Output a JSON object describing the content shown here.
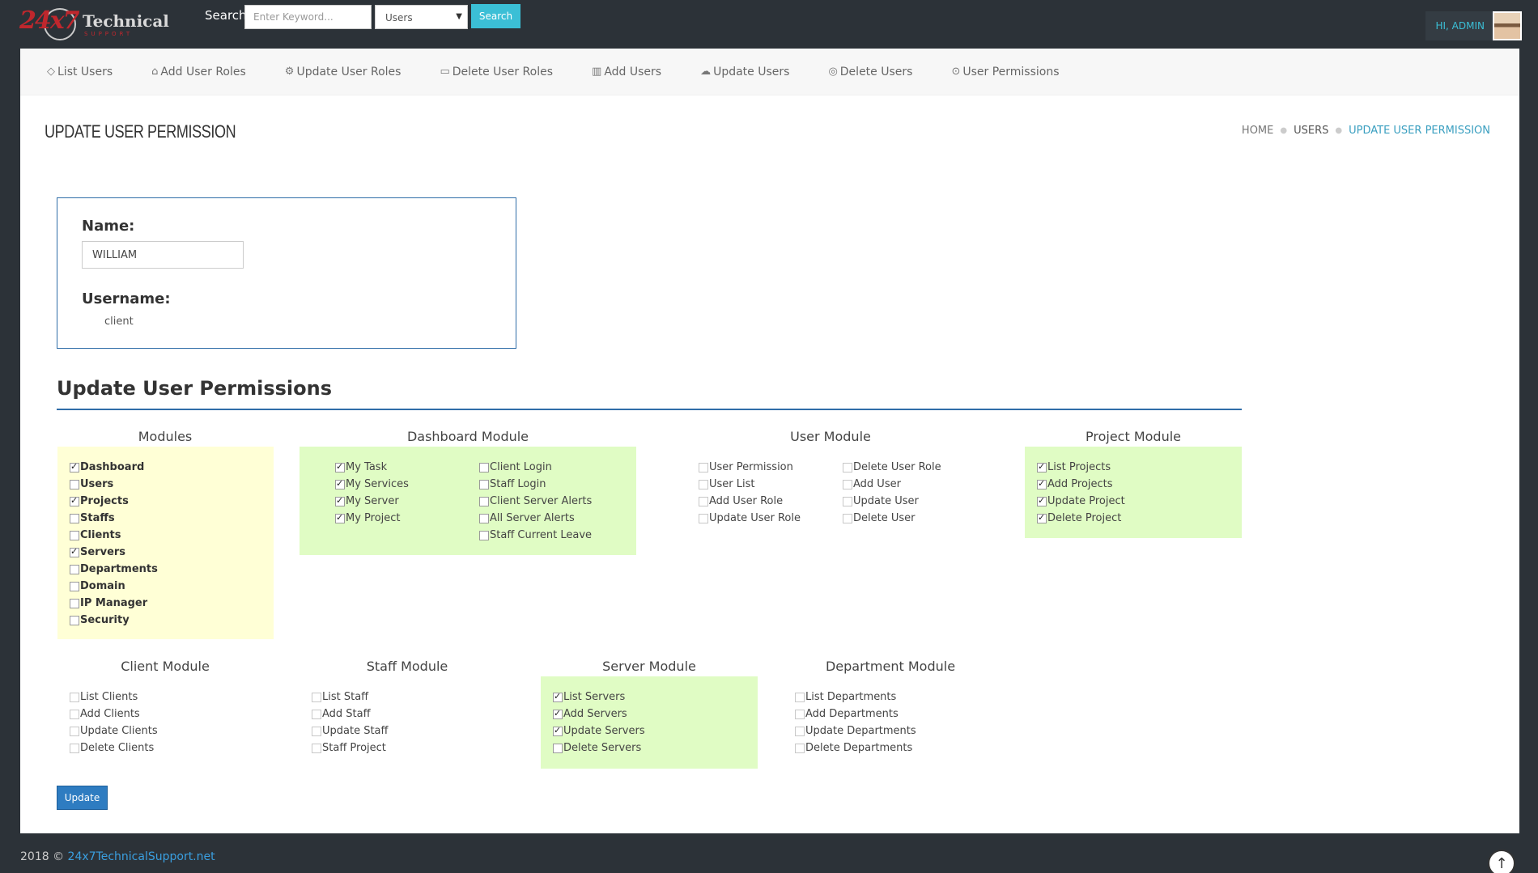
{
  "brand": {
    "logo_number": "24x7",
    "logo_text": "Technical",
    "logo_sub": "SUPPORT"
  },
  "search": {
    "label": "Search",
    "placeholder": "Enter Keyword...",
    "select_value": "Users",
    "button_label": "Search"
  },
  "user": {
    "greeting": "HI, ADMIN"
  },
  "nav": {
    "items": [
      {
        "label": "List Users",
        "icon": "diamond-icon",
        "glyph": "◇"
      },
      {
        "label": "Add User Roles",
        "icon": "tag-icon",
        "glyph": "⌂"
      },
      {
        "label": "Update User Roles",
        "icon": "gear-icon",
        "glyph": "⚙"
      },
      {
        "label": "Delete User Roles",
        "icon": "folder-icon",
        "glyph": "▭"
      },
      {
        "label": "Add Users",
        "icon": "bar-chart-icon",
        "glyph": "▥"
      },
      {
        "label": "Update Users",
        "icon": "cloud-upload-icon",
        "glyph": "☁"
      },
      {
        "label": "Delete Users",
        "icon": "globe-icon",
        "glyph": "◎"
      },
      {
        "label": "User Permissions",
        "icon": "map-pin-icon",
        "glyph": "⊙"
      }
    ]
  },
  "page": {
    "title": "UPDATE USER PERMISSION",
    "breadcrumb": [
      "HOME",
      "USERS",
      "UPDATE USER PERMISSION"
    ]
  },
  "profile": {
    "name_label": "Name:",
    "name_value": "WILLIAM",
    "username_label": "Username:",
    "username_value": "client"
  },
  "permissions": {
    "heading": "Update User Permissions",
    "update_label": "Update",
    "modules": {
      "title": "Modules",
      "items": [
        {
          "label": "Dashboard",
          "checked": true
        },
        {
          "label": "Users",
          "checked": false
        },
        {
          "label": "Projects",
          "checked": true
        },
        {
          "label": "Staffs",
          "checked": false
        },
        {
          "label": "Clients",
          "checked": false
        },
        {
          "label": "Servers",
          "checked": true
        },
        {
          "label": "Departments",
          "checked": false
        },
        {
          "label": "Domain",
          "checked": false
        },
        {
          "label": "IP Manager",
          "checked": false
        },
        {
          "label": "Security",
          "checked": false
        }
      ]
    },
    "dashboard": {
      "title": "Dashboard Module",
      "col1": [
        {
          "label": "My Task",
          "checked": true
        },
        {
          "label": "My Services",
          "checked": true
        },
        {
          "label": "My Server",
          "checked": true
        },
        {
          "label": "My Project",
          "checked": true
        }
      ],
      "col2": [
        {
          "label": "Client Login",
          "checked": false
        },
        {
          "label": "Staff Login",
          "checked": false
        },
        {
          "label": "Client Server Alerts",
          "checked": false
        },
        {
          "label": "All Server Alerts",
          "checked": false
        },
        {
          "label": "Staff Current Leave",
          "checked": false
        }
      ]
    },
    "user_module": {
      "title": "User Module",
      "col1": [
        {
          "label": "User Permission",
          "checked": false
        },
        {
          "label": "User List",
          "checked": false
        },
        {
          "label": "Add User Role",
          "checked": false
        },
        {
          "label": "Update User Role",
          "checked": false
        }
      ],
      "col2": [
        {
          "label": "Delete User Role",
          "checked": false
        },
        {
          "label": "Add User",
          "checked": false
        },
        {
          "label": "Update User",
          "checked": false
        },
        {
          "label": "Delete User",
          "checked": false
        }
      ]
    },
    "project_module": {
      "title": "Project Module",
      "items": [
        {
          "label": "List Projects",
          "checked": true
        },
        {
          "label": "Add Projects",
          "checked": true
        },
        {
          "label": "Update Project",
          "checked": true
        },
        {
          "label": "Delete Project",
          "checked": true
        }
      ]
    },
    "client_module": {
      "title": "Client Module",
      "items": [
        {
          "label": "List Clients",
          "checked": false
        },
        {
          "label": "Add Clients",
          "checked": false
        },
        {
          "label": "Update Clients",
          "checked": false
        },
        {
          "label": "Delete Clients",
          "checked": false
        }
      ]
    },
    "staff_module": {
      "title": "Staff Module",
      "items": [
        {
          "label": "List Staff",
          "checked": false
        },
        {
          "label": "Add Staff",
          "checked": false
        },
        {
          "label": "Update Staff",
          "checked": false
        },
        {
          "label": "Staff Project",
          "checked": false
        }
      ]
    },
    "server_module": {
      "title": "Server Module",
      "items": [
        {
          "label": "List Servers",
          "checked": true
        },
        {
          "label": "Add Servers",
          "checked": true
        },
        {
          "label": "Update Servers",
          "checked": true
        },
        {
          "label": "Delete Servers",
          "checked": false
        }
      ]
    },
    "department_module": {
      "title": "Department Module",
      "items": [
        {
          "label": "List Departments",
          "checked": false
        },
        {
          "label": "Add Departments",
          "checked": false
        },
        {
          "label": "Update Departments",
          "checked": false
        },
        {
          "label": "Delete Departments",
          "checked": false
        }
      ]
    }
  },
  "footer": {
    "prefix": "2018 ©",
    "link": "24x7TechnicalSupport.net"
  },
  "colors": {
    "topbar": "#2c3238",
    "accent": "#3bbfd6",
    "primary": "#2e7cc1",
    "yellow_box": "#ffffd6",
    "green_box": "#e0fcc4"
  }
}
